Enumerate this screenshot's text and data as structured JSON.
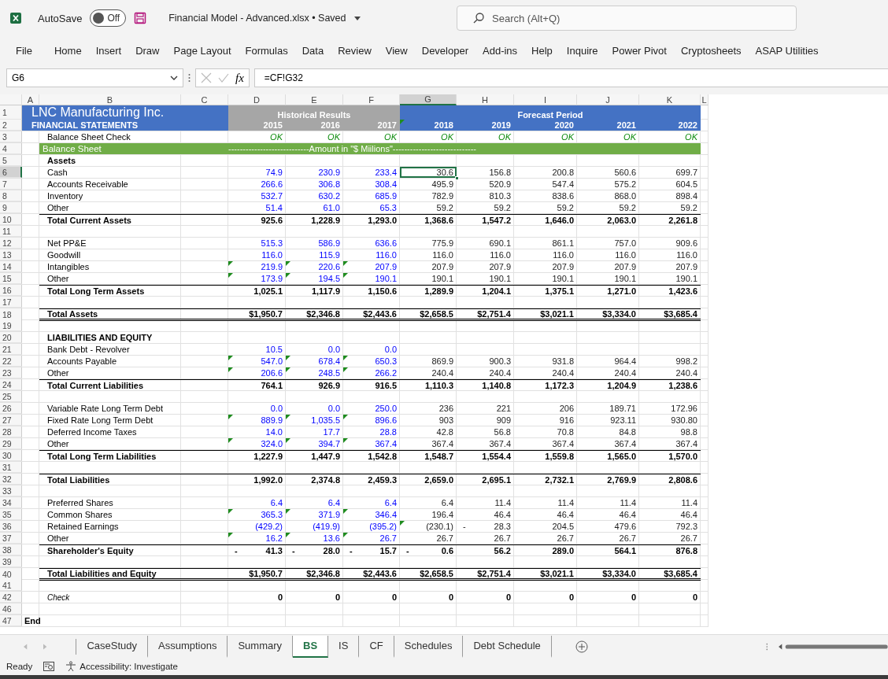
{
  "title_bar": {
    "autosave_label": "AutoSave",
    "autosave": {
      "on": false,
      "label": "Off"
    },
    "document": "Financial Model - Advanced.xlsx • Saved",
    "search": {
      "placeholder": "Search (Alt+Q)"
    }
  },
  "ribbon_tabs": [
    "File",
    "Home",
    "Insert",
    "Draw",
    "Page Layout",
    "Formulas",
    "Data",
    "Review",
    "View",
    "Developer",
    "Add-ins",
    "Help",
    "Inquire",
    "Power Pivot",
    "Cryptosheets",
    "ASAP Utilities"
  ],
  "formula_bar": {
    "name_box": "G6",
    "fx_label": "fx",
    "formula": "=CF!G32"
  },
  "columns": [
    "A",
    "B",
    "C",
    "D",
    "E",
    "F",
    "G",
    "H",
    "I",
    "J",
    "K",
    "L"
  ],
  "rows": [
    {
      "num": "1",
      "kind": "title",
      "label": "LNC Manufacturing Inc.",
      "hist_title": "Historical Results",
      "fore_title": "Forecast Period"
    },
    {
      "num": "2",
      "kind": "years",
      "label": "FINANCIAL STATEMENTS",
      "values": [
        "2015",
        "2016",
        "2017",
        "2018",
        "2019",
        "2020",
        "2021",
        "2022"
      ],
      "flags": [
        false,
        false,
        false,
        true,
        false,
        false,
        false,
        false
      ]
    },
    {
      "num": "3",
      "kind": "status",
      "label": "Balance Sheet Check",
      "values": [
        "OK",
        "OK",
        "OK",
        "OK",
        "OK",
        "OK",
        "OK",
        "OK"
      ]
    },
    {
      "num": "4",
      "kind": "section",
      "label": "Balance Sheet",
      "note": "----------------------------Amount in \"$ Miilions\"-----------------------------"
    },
    {
      "num": "5",
      "kind": "heading",
      "label": "Assets"
    },
    {
      "num": "6",
      "kind": "item",
      "label": "Cash",
      "values": [
        "74.9",
        "230.9",
        "233.4",
        "30.6",
        "156.8",
        "200.8",
        "560.6",
        "699.7"
      ]
    },
    {
      "num": "7",
      "kind": "item",
      "label": "Accounts Receivable",
      "values": [
        "266.6",
        "306.8",
        "308.4",
        "495.9",
        "520.9",
        "547.4",
        "575.2",
        "604.5"
      ]
    },
    {
      "num": "8",
      "kind": "item",
      "label": "Inventory",
      "values": [
        "532.7",
        "630.2",
        "685.9",
        "782.9",
        "810.3",
        "838.6",
        "868.0",
        "898.4"
      ]
    },
    {
      "num": "9",
      "kind": "item",
      "label": "Other",
      "values": [
        "51.4",
        "61.0",
        "65.3",
        "59.2",
        "59.2",
        "59.2",
        "59.2",
        "59.2"
      ]
    },
    {
      "num": "10",
      "kind": "total",
      "label": "Total Current Assets",
      "values": [
        "925.6",
        "1,228.9",
        "1,293.0",
        "1,368.6",
        "1,547.2",
        "1,646.0",
        "2,063.0",
        "2,261.8"
      ]
    },
    {
      "num": "11",
      "kind": "blank"
    },
    {
      "num": "12",
      "kind": "item",
      "label": "Net PP&E",
      "values": [
        "515.3",
        "586.9",
        "636.6",
        "775.9",
        "690.1",
        "861.1",
        "757.0",
        "909.6"
      ]
    },
    {
      "num": "13",
      "kind": "item",
      "label": "Goodwill",
      "values": [
        "116.0",
        "115.9",
        "116.0",
        "116.0",
        "116.0",
        "116.0",
        "116.0",
        "116.0"
      ]
    },
    {
      "num": "14",
      "kind": "item",
      "label": "Intangibles",
      "values": [
        "219.9",
        "220.6",
        "207.9",
        "207.9",
        "207.9",
        "207.9",
        "207.9",
        "207.9"
      ],
      "flags": [
        true,
        true,
        true,
        false,
        false,
        false,
        false,
        false
      ]
    },
    {
      "num": "15",
      "kind": "item",
      "label": "Other",
      "values": [
        "173.9",
        "194.5",
        "190.1",
        "190.1",
        "190.1",
        "190.1",
        "190.1",
        "190.1"
      ],
      "flags": [
        true,
        true,
        true,
        false,
        false,
        false,
        false,
        false
      ]
    },
    {
      "num": "16",
      "kind": "total",
      "label": "Total Long Term Assets",
      "values": [
        "1,025.1",
        "1,117.9",
        "1,150.6",
        "1,289.9",
        "1,204.1",
        "1,375.1",
        "1,271.0",
        "1,423.6"
      ]
    },
    {
      "num": "17",
      "kind": "blank"
    },
    {
      "num": "18",
      "kind": "grand",
      "label": "Total Assets",
      "values": [
        "$1,950.7",
        "$2,346.8",
        "$2,443.6",
        "$2,658.5",
        "$2,751.4",
        "$3,021.1",
        "$3,334.0",
        "$3,685.4"
      ]
    },
    {
      "num": "19",
      "kind": "blank"
    },
    {
      "num": "20",
      "kind": "heading",
      "label": "LIABILITIES AND EQUITY"
    },
    {
      "num": "21",
      "kind": "item",
      "label": "Bank Debt - Revolver",
      "values": [
        "10.5",
        "0.0",
        "0.0"
      ]
    },
    {
      "num": "22",
      "kind": "item",
      "label": "Accounts Payable",
      "values": [
        "547.0",
        "678.4",
        "650.3",
        "869.9",
        "900.3",
        "931.8",
        "964.4",
        "998.2"
      ],
      "flags": [
        true,
        true,
        true,
        false,
        false,
        false,
        false,
        false
      ]
    },
    {
      "num": "23",
      "kind": "item",
      "label": "Other",
      "values": [
        "206.6",
        "248.5",
        "266.2",
        "240.4",
        "240.4",
        "240.4",
        "240.4",
        "240.4"
      ],
      "flags": [
        true,
        true,
        true,
        false,
        false,
        false,
        false,
        false
      ]
    },
    {
      "num": "24",
      "kind": "total",
      "label": "Total Current Liabilities",
      "values": [
        "764.1",
        "926.9",
        "916.5",
        "1,110.3",
        "1,140.8",
        "1,172.3",
        "1,204.9",
        "1,238.6"
      ]
    },
    {
      "num": "25",
      "kind": "blank"
    },
    {
      "num": "26",
      "kind": "item",
      "label": "Variable Rate Long Term Debt",
      "values": [
        "0.0",
        "0.0",
        "250.0",
        "236",
        "221",
        "206",
        "189.71",
        "172.96"
      ]
    },
    {
      "num": "27",
      "kind": "item",
      "label": "Fixed Rate Long Term Debt",
      "values": [
        "889.9",
        "1,035.5",
        "896.6",
        "903",
        "909",
        "916",
        "923.11",
        "930.80"
      ],
      "flags": [
        true,
        true,
        true,
        false,
        false,
        false,
        false,
        false
      ]
    },
    {
      "num": "28",
      "kind": "item",
      "label": "Deferred Income Taxes",
      "values": [
        "14.0",
        "17.7",
        "28.8",
        "42.8",
        "56.8",
        "70.8",
        "84.8",
        "98.8"
      ]
    },
    {
      "num": "29",
      "kind": "item",
      "label": "Other",
      "values": [
        "324.0",
        "394.7",
        "367.4",
        "367.4",
        "367.4",
        "367.4",
        "367.4",
        "367.4"
      ],
      "flags": [
        true,
        true,
        true,
        false,
        false,
        false,
        false,
        false
      ]
    },
    {
      "num": "30",
      "kind": "total",
      "label": "Total Long Term Liabilities",
      "values": [
        "1,227.9",
        "1,447.9",
        "1,542.8",
        "1,548.7",
        "1,554.4",
        "1,559.8",
        "1,565.0",
        "1,570.0"
      ]
    },
    {
      "num": "31",
      "kind": "blank"
    },
    {
      "num": "32",
      "kind": "total",
      "label": "Total Liabilities",
      "values": [
        "1,992.0",
        "2,374.8",
        "2,459.3",
        "2,659.0",
        "2,695.1",
        "2,732.1",
        "2,769.9",
        "2,808.6"
      ]
    },
    {
      "num": "33",
      "kind": "blank"
    },
    {
      "num": "34",
      "kind": "item",
      "label": "Preferred Shares",
      "values": [
        "6.4",
        "6.4",
        "6.4",
        "6.4",
        "11.4",
        "11.4",
        "11.4",
        "11.4"
      ]
    },
    {
      "num": "35",
      "kind": "item",
      "label": "Common Shares",
      "values": [
        "365.3",
        "371.9",
        "346.4",
        "196.4",
        "46.4",
        "46.4",
        "46.4",
        "46.4"
      ],
      "flags": [
        true,
        true,
        true,
        false,
        false,
        false,
        false,
        false
      ]
    },
    {
      "num": "36",
      "kind": "item",
      "label": "Retained Earnings",
      "values": [
        "(429.2)",
        "(419.9)",
        "(395.2)",
        "(230.1)",
        {
          "lead": "-",
          "text": "28.3"
        },
        "204.5",
        "479.6",
        "792.3"
      ],
      "flags": [
        false,
        false,
        false,
        true,
        false,
        false,
        false,
        false
      ]
    },
    {
      "num": "37",
      "kind": "item",
      "label": "Other",
      "values": [
        "16.2",
        "13.6",
        "26.7",
        "26.7",
        "26.7",
        "26.7",
        "26.7",
        "26.7"
      ],
      "flags": [
        true,
        true,
        true,
        false,
        false,
        false,
        false,
        false
      ]
    },
    {
      "num": "38",
      "kind": "total",
      "label": "Shareholder's Equity",
      "values": [
        {
          "lead": "-",
          "text": "41.3"
        },
        {
          "lead": "-",
          "text": "28.0"
        },
        {
          "lead": "-",
          "text": "15.7"
        },
        {
          "lead": "-",
          "text": "0.6"
        },
        "56.2",
        "289.0",
        "564.1",
        "876.8"
      ]
    },
    {
      "num": "39",
      "kind": "blank"
    },
    {
      "num": "40",
      "kind": "grand",
      "label": "Total Liabilities and Equity",
      "values": [
        "$1,950.7",
        "$2,346.8",
        "$2,443.6",
        "$2,658.5",
        "$2,751.4",
        "$3,021.1",
        "$3,334.0",
        "$3,685.4"
      ]
    },
    {
      "num": "41",
      "kind": "blank"
    },
    {
      "num": "42",
      "kind": "check",
      "label": "Check",
      "values": [
        "0",
        "0",
        "0",
        "0",
        "0",
        "0",
        "0",
        "0"
      ]
    },
    {
      "num": "46",
      "kind": "blank"
    },
    {
      "num": "47",
      "kind": "end",
      "label": "End"
    }
  ],
  "sheet_tabs": [
    {
      "label": "CaseStudy",
      "selected": false
    },
    {
      "label": "Assumptions",
      "selected": false
    },
    {
      "label": "Summary",
      "selected": false
    },
    {
      "label": "BS",
      "selected": true
    },
    {
      "label": "IS",
      "selected": false
    },
    {
      "label": "CF",
      "selected": false
    },
    {
      "label": "Schedules",
      "selected": false
    },
    {
      "label": "Debt Schedule",
      "selected": false
    }
  ],
  "status_bar": {
    "mode": "Ready",
    "accessibility": "Accessibility: Investigate"
  }
}
